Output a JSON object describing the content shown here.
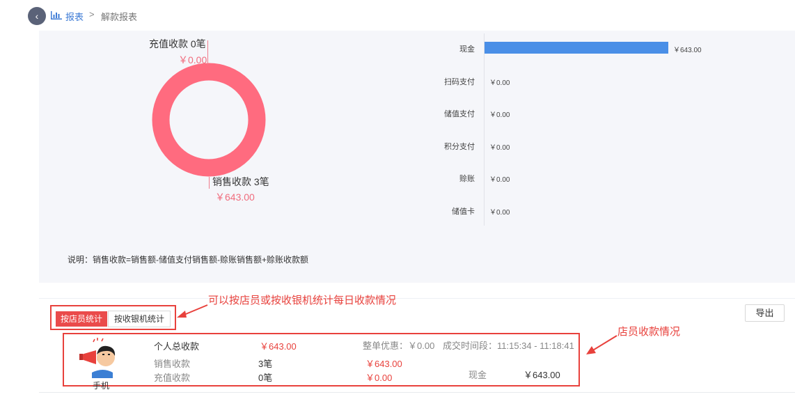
{
  "breadcrumb": {
    "back": "‹",
    "report": "报表",
    "separator": ">",
    "current": "解款报表"
  },
  "donut": {
    "recharge_label": "充值收款 0笔",
    "recharge_amount": "￥0.00",
    "sales_label": "销售收款 3笔",
    "sales_amount": "￥643.00",
    "color": "#ff6b7f"
  },
  "chart_data": {
    "type": "bar",
    "orientation": "horizontal",
    "categories": [
      "现金",
      "扫码支付",
      "储值支付",
      "积分支付",
      "赊账",
      "储值卡"
    ],
    "values": [
      643.0,
      0.0,
      0.0,
      0.0,
      0.0,
      0.0
    ],
    "value_labels": [
      "￥643.00",
      "￥0.00",
      "￥0.00",
      "￥0.00",
      "￥0.00",
      "￥0.00"
    ],
    "bar_color": "#4a8fe7",
    "xlim": [
      0,
      643
    ]
  },
  "note": "说明：销售收款=销售额-储值支付销售额-赊账销售额+赊账收款额",
  "annotations": {
    "tabs_note": "可以按店员或按收银机统计每日收款情况",
    "staff_note": "店员收款情况",
    "color": "#e8413c"
  },
  "tabs": {
    "by_staff": "按店员统计",
    "by_register": "按收银机统计"
  },
  "export_label": "导出",
  "staff": {
    "name": "手机",
    "total_label": "个人总收款",
    "total_amount": "￥643.00",
    "discount": "整单优惠：￥0.00",
    "time_range": "成交时间段：11:15:34 - 11:18:41",
    "sales_label": "销售收款",
    "sales_count": "3笔",
    "sales_amount": "￥643.00",
    "recharge_label": "充值收款",
    "recharge_count": "0笔",
    "recharge_amount": "￥0.00",
    "cash_label": "现金",
    "cash_amount": "￥643.00"
  }
}
